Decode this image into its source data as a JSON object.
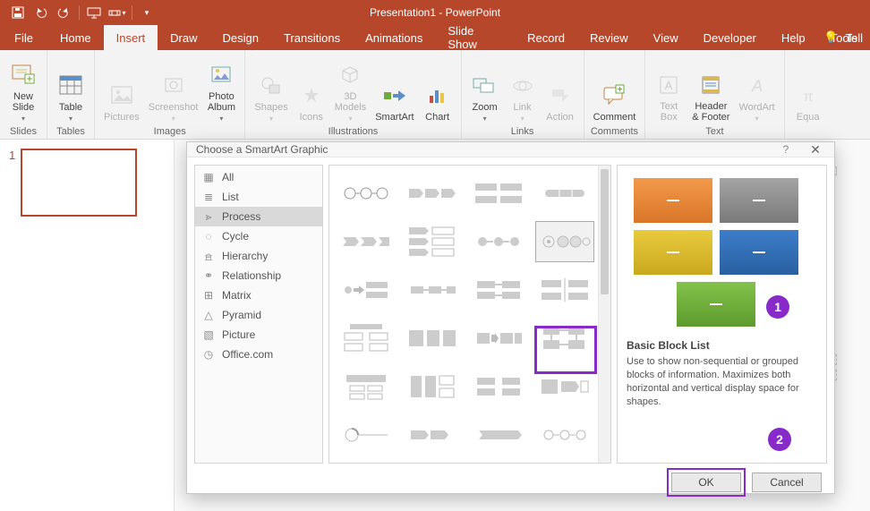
{
  "app": {
    "title": "Presentation1 - PowerPoint"
  },
  "qat": {
    "tip": "▾"
  },
  "tabs": {
    "file": "File",
    "items": [
      "Home",
      "Insert",
      "Draw",
      "Design",
      "Transitions",
      "Animations",
      "Slide Show",
      "Record",
      "Review",
      "View",
      "Developer",
      "Help",
      "Tools"
    ],
    "active": "Insert",
    "tell": "Tell"
  },
  "ribbon": {
    "slides": {
      "new_slide": "New\nSlide",
      "group": "Slides"
    },
    "tables": {
      "table": "Table",
      "group": "Tables"
    },
    "images": {
      "pictures": "Pictures",
      "screenshot": "Screenshot",
      "photo_album": "Photo\nAlbum",
      "group": "Images"
    },
    "illus": {
      "shapes": "Shapes",
      "icons": "Icons",
      "models": "3D\nModels",
      "smartart": "SmartArt",
      "chart": "Chart",
      "group": "Illustrations"
    },
    "links": {
      "zoom": "Zoom",
      "link": "Link",
      "action": "Action",
      "group": "Links"
    },
    "comments": {
      "comment": "Comment",
      "group": "Comments"
    },
    "text": {
      "text_box": "Text\nBox",
      "header_footer": "Header\n& Footer",
      "wordart": "WordArt",
      "group": "Text"
    },
    "symbols": {
      "equation": "Equa"
    }
  },
  "thumb": {
    "num": "1"
  },
  "dialog": {
    "title": "Choose a SmartArt Graphic",
    "categories": [
      "All",
      "List",
      "Process",
      "Cycle",
      "Hierarchy",
      "Relationship",
      "Matrix",
      "Pyramid",
      "Picture",
      "Office.com"
    ],
    "selected_category": "Process",
    "preview": {
      "heading": "Basic Block List",
      "text": "Use to show non-sequential or grouped blocks of information. Maximizes both horizontal and vertical display space for shapes.",
      "colors": {
        "orange": "#e08427",
        "gray": "#8f8f8f",
        "gold": "#d9b727",
        "blue": "#2f6db5",
        "green": "#6eab3a"
      }
    },
    "buttons": {
      "ok": "OK",
      "cancel": "Cancel"
    }
  },
  "annotations": {
    "one": "1",
    "two": "2"
  }
}
